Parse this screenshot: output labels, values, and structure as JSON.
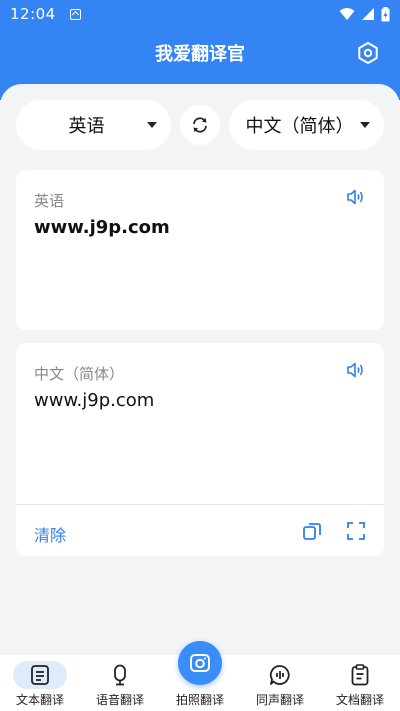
{
  "status_bar": {
    "time": "12:04"
  },
  "header": {
    "title": "我爱翻译官"
  },
  "languages": {
    "source": "英语",
    "target": "中文（简体）"
  },
  "source_card": {
    "label": "英语",
    "text": "www.j9p.com"
  },
  "target_card": {
    "label": "中文（简体）",
    "text": "www.j9p.com",
    "clear_label": "清除"
  },
  "nav": {
    "items": [
      {
        "label": "文本翻译",
        "icon": "document-text-icon",
        "active": true
      },
      {
        "label": "语音翻译",
        "icon": "microphone-icon",
        "active": false
      },
      {
        "label": "拍照翻译",
        "icon": "camera-icon",
        "active": false
      },
      {
        "label": "同声翻译",
        "icon": "chat-wave-icon",
        "active": false
      },
      {
        "label": "文档翻译",
        "icon": "clipboard-icon",
        "active": false
      }
    ]
  },
  "colors": {
    "primary": "#3484f3",
    "accent_text": "#2f80ed",
    "background": "#f3f4f6"
  }
}
